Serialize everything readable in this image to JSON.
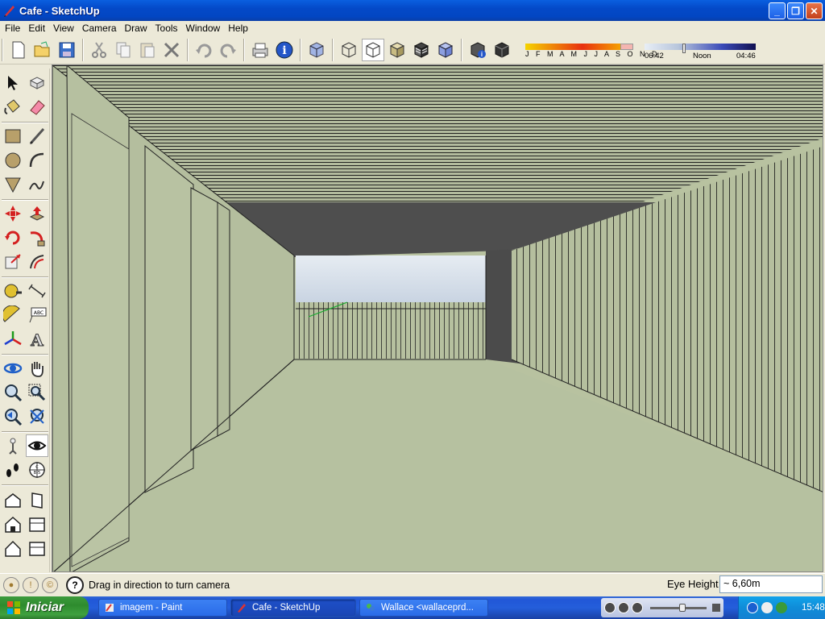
{
  "window": {
    "title": "Cafe - SketchUp"
  },
  "menu": [
    "File",
    "Edit",
    "View",
    "Camera",
    "Draw",
    "Tools",
    "Window",
    "Help"
  ],
  "shadow": {
    "months": "J F M A M J J A S O N D",
    "time_start": "06:42",
    "time_mid": "Noon",
    "time_end": "04:46"
  },
  "status": {
    "message": "Drag in direction to turn camera",
    "measure_label": "Eye Height",
    "measure_value": "~ 6,60m"
  },
  "taskbar": {
    "start": "Iniciar",
    "tasks": [
      "imagem - Paint",
      "Cafe - SketchUp",
      "Wallace <wallaceprd..."
    ],
    "clock": "15:48"
  },
  "colors": {
    "wall": "#b8c2a0",
    "ceiling": "#4d4d4d",
    "sky": "#e8eef4"
  }
}
